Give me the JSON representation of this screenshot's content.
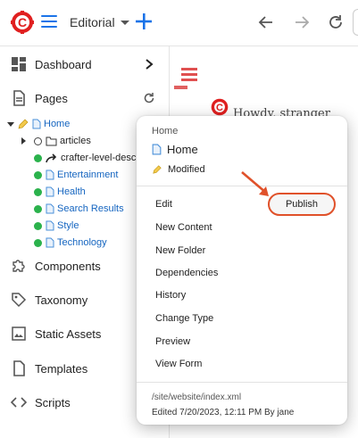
{
  "topbar": {
    "site_name": "Editorial",
    "colors": {
      "brand_red": "#e02020",
      "accent_blue": "#1a73e8"
    }
  },
  "sidebar": {
    "items": [
      {
        "label": "Dashboard",
        "icon": "dashboard-icon"
      },
      {
        "label": "Pages",
        "icon": "page-icon"
      },
      {
        "label": "Components",
        "icon": "puzzle-icon"
      },
      {
        "label": "Taxonomy",
        "icon": "tag-icon"
      },
      {
        "label": "Static Assets",
        "icon": "image-icon"
      },
      {
        "label": "Templates",
        "icon": "file-icon"
      },
      {
        "label": "Scripts",
        "icon": "code-icon"
      }
    ],
    "tree": {
      "root": "Home",
      "children": [
        {
          "label": "articles"
        },
        {
          "label": "crafter-level-descri"
        },
        {
          "label": "Entertainment"
        },
        {
          "label": "Health"
        },
        {
          "label": "Search Results"
        },
        {
          "label": "Style"
        },
        {
          "label": "Technology"
        }
      ]
    }
  },
  "preview": {
    "greeting": "Howdy, stranger"
  },
  "context_menu": {
    "header_label": "Home",
    "page_name": "Home",
    "status": "Modified",
    "items": [
      "Edit",
      "New Content",
      "New Folder",
      "Dependencies",
      "History",
      "Change Type",
      "Preview",
      "View Form"
    ],
    "publish_label": "Publish",
    "path": "/site/website/index.xml",
    "edited": "Edited 7/20/2023, 12:11 PM By jane"
  }
}
